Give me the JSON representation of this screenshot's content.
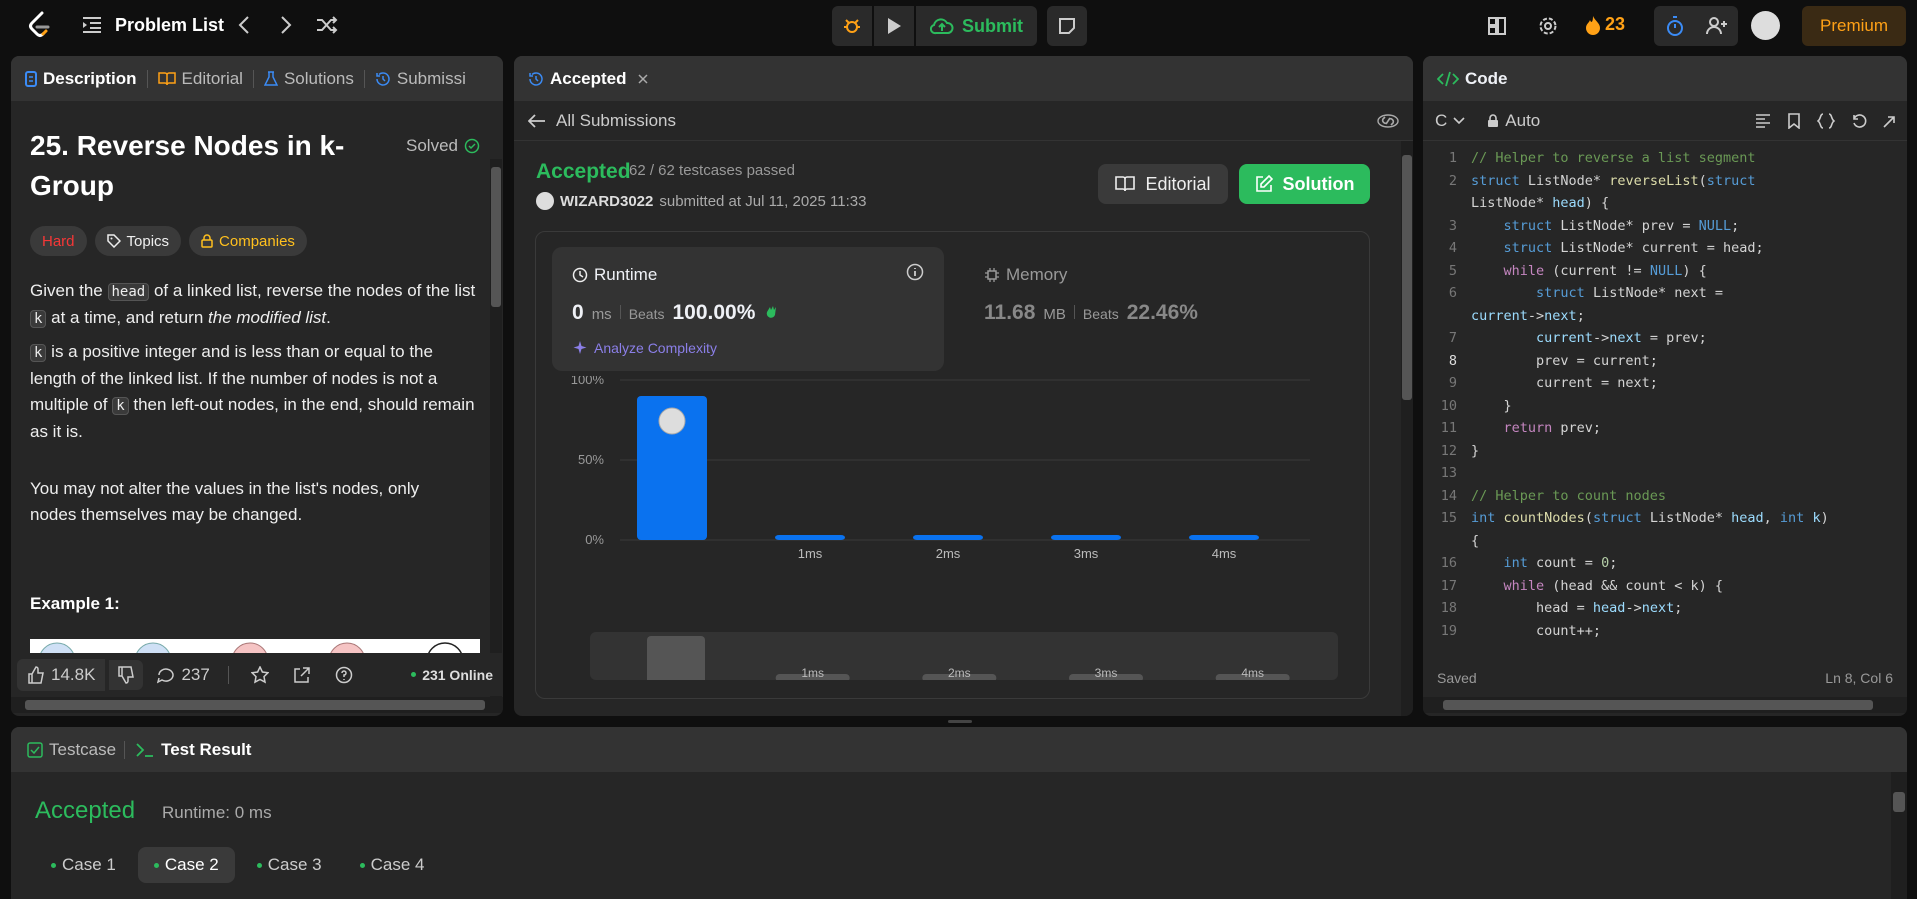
{
  "nav": {
    "title": "Problem List",
    "submit_label": "Submit",
    "streak": "23",
    "premium_label": "Premium"
  },
  "desc": {
    "tabs": [
      "Description",
      "Editorial",
      "Solutions",
      "Submissi"
    ],
    "title": "25. Reverse Nodes in k-Group",
    "solved_label": "Solved",
    "chips": [
      "Hard",
      "Topics",
      "Companies"
    ],
    "p1_a": "Given the ",
    "p1_code1": "head",
    "p1_b": " of a linked list, reverse the nodes of the list ",
    "p1_code2": "k",
    "p1_c": " at a time, and return ",
    "p1_em": "the modified list",
    "p1_d": ".",
    "p2_code": "k",
    "p2_a": " is a positive integer and is less than or equal to the length of the linked list. If the number of nodes is not a multiple of ",
    "p2_code2": "k",
    "p2_b": " then left-out nodes, in the end, should remain as it is.",
    "p3": "You may not alter the values in the list's nodes, only nodes themselves may be changed.",
    "example_title": "Example 1:",
    "likes": "14.8K",
    "comments": "237",
    "online": "231 Online"
  },
  "submission": {
    "tab": "Accepted",
    "back_label": "All Submissions",
    "status": "Accepted",
    "testcases": "62 / 62 testcases passed",
    "user": "WIZARD3022",
    "submitted_text": "submitted at Jul 11, 2025 11:33",
    "editorial_btn": "Editorial",
    "solution_btn": "Solution",
    "runtime": {
      "label": "Runtime",
      "value": "0",
      "unit": "ms",
      "beats_label": "Beats",
      "beats": "100.00%",
      "analyze": "Analyze Complexity"
    },
    "memory": {
      "label": "Memory",
      "value": "11.68",
      "unit": "MB",
      "beats_label": "Beats",
      "beats": "22.46%"
    }
  },
  "chart_data": {
    "type": "bar",
    "categories": [
      "",
      "1ms",
      "2ms",
      "3ms",
      "4ms"
    ],
    "values": [
      90,
      2,
      2,
      2,
      2
    ],
    "y_ticks": [
      "100%",
      "50%",
      "0%"
    ],
    "ylim": [
      0,
      100
    ],
    "colors": {
      "bar": "#0a72ef",
      "grid": "#3a3a3a"
    }
  },
  "code": {
    "tab": "Code",
    "lang": "C",
    "mode": "Auto",
    "saved": "Saved",
    "cursor": "Ln 8, Col 6"
  },
  "result": {
    "tabs": [
      "Testcase",
      "Test Result"
    ],
    "status": "Accepted",
    "runtime": "Runtime: 0 ms",
    "cases": [
      "Case 1",
      "Case 2",
      "Case 3",
      "Case 4"
    ]
  },
  "colors": {
    "accent": "#2cbb5d",
    "streak": "#ffa116",
    "hard": "#f63737",
    "companies": "#ffc01e"
  }
}
